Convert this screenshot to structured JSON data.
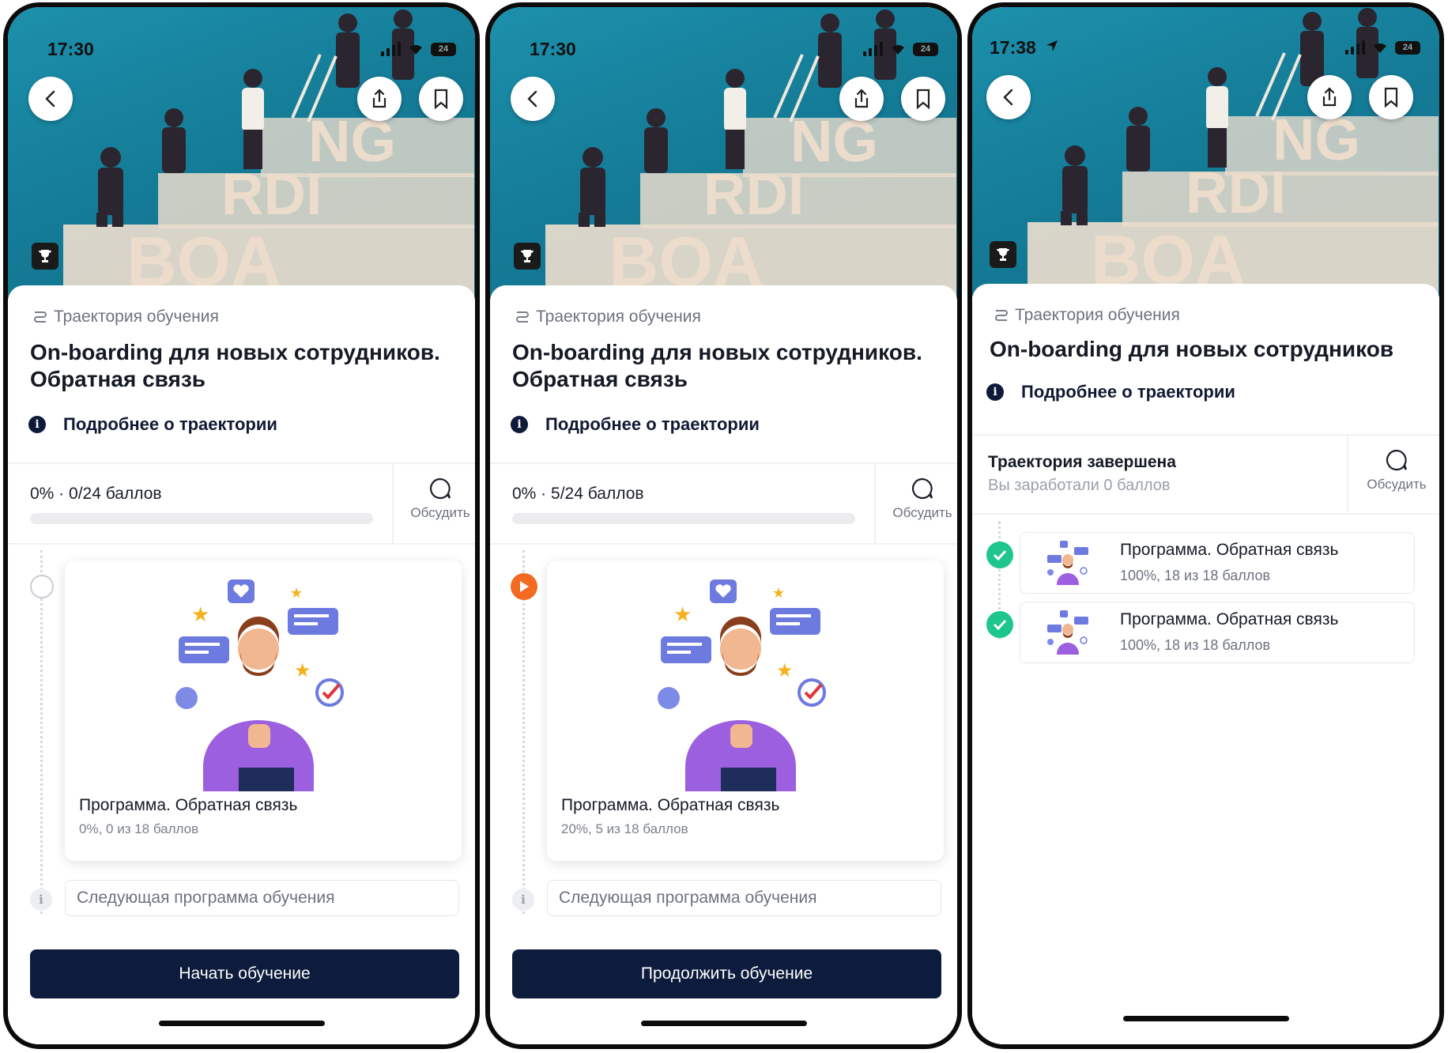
{
  "screens": [
    {
      "status": {
        "time": "17:30",
        "battery": "24"
      },
      "tag": "Траектория обучения",
      "title": "On-boarding для новых сотрудников. Обратная связь",
      "more_label": "Подробнее о траектории",
      "progress_text": "0% · 0/24 баллов",
      "progress_value": 0,
      "discuss_label": "Обсудить",
      "step_state": "not-started",
      "card": {
        "title": "Программа. Обратная связь",
        "subtitle": "0%, 0 из 18 баллов"
      },
      "next_label": "Следующая программа обучения",
      "cta_label": "Начать обучение"
    },
    {
      "status": {
        "time": "17:30",
        "battery": "24"
      },
      "tag": "Траектория обучения",
      "title": "On-boarding для новых сотрудников. Обратная связь",
      "more_label": "Подробнее о траектории",
      "progress_text": "0% · 5/24 баллов",
      "progress_value": 0,
      "discuss_label": "Обсудить",
      "step_state": "in-progress",
      "card": {
        "title": "Программа. Обратная связь",
        "subtitle": "20%, 5 из 18 баллов"
      },
      "next_label": "Следующая программа обучения",
      "cta_label": "Продолжить обучение"
    },
    {
      "status": {
        "time": "17:38",
        "battery": "24"
      },
      "tag": "Траектория обучения",
      "title": "On-boarding для новых сотрудников",
      "more_label": "Подробнее о траектории",
      "completed_title": "Траектория завершена",
      "completed_sub": "Вы заработали 0 баллов",
      "discuss_label": "Обсудить",
      "programs": [
        {
          "title": "Программа. Обратная связь",
          "subtitle": "100%, 18 из 18 баллов",
          "state": "completed"
        },
        {
          "title": "Программа. Обратная связь",
          "subtitle": "100%, 18 из 18 баллов",
          "state": "completed"
        }
      ]
    }
  ],
  "hero_text": [
    "NG",
    "RDI",
    "BOA"
  ],
  "colors": {
    "primary": "#0d1b3c",
    "accent_orange": "#f36a21",
    "success": "#1ec68d",
    "hero_teal": "#1789a5",
    "illustration_purple": "#9b5fe0"
  },
  "icons": [
    "back-arrow-icon",
    "share-icon",
    "bookmark-icon",
    "trophy-icon",
    "route-icon",
    "info-icon",
    "chat-bubble-icon",
    "play-icon",
    "check-icon"
  ]
}
